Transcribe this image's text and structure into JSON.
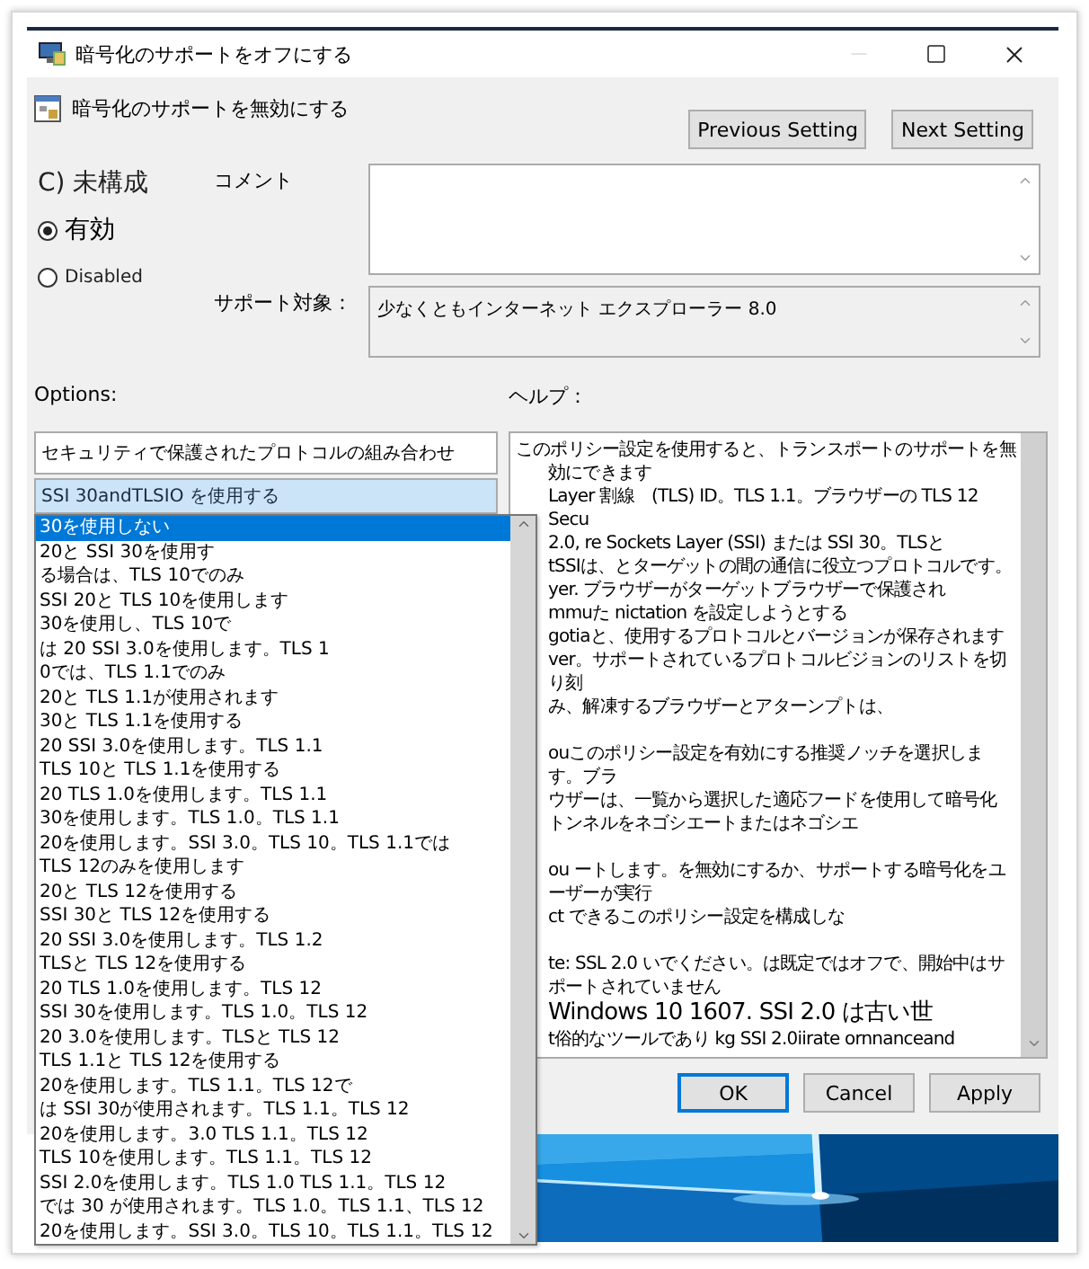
{
  "window": {
    "title": "暗号化のサポートをオフにする"
  },
  "header": {
    "title": "暗号化のサポートを無効にする",
    "buttons": [
      "Previous Setting",
      "Next Setting"
    ]
  },
  "radios": [
    {
      "label": "C) 未構成",
      "kind": "plain",
      "selected": false
    },
    {
      "label": "有効",
      "kind": "radio",
      "selected": true
    },
    {
      "label": "Disabled",
      "kind": "radio",
      "selected": false
    }
  ],
  "comment": {
    "label": "コメント"
  },
  "supported_on": {
    "label": "サポート対象：",
    "value": "少なくともインターネット エクスプローラー 8.0"
  },
  "options": {
    "label": "Options:",
    "group_label": "セキュリティで保護されたプロトコルの組み合わせ",
    "combo_value": "SSI  30andTLSIO を使用する",
    "list": [
      {
        "label": "30を使用しない",
        "selected": true
      },
      {
        "label": "20と SSI 30を使用す",
        "selected": false
      },
      {
        "label": "る場合は、TLS 10でのみ",
        "selected": false
      },
      {
        "label": "SSI 20と TLS 10を使用します",
        "selected": false
      },
      {
        "label": "30を使用し、TLS 10で",
        "selected": false
      },
      {
        "label": "は 20 SSI 3.0を使用します。TLS 1",
        "selected": false
      },
      {
        "label": "0では、TLS 1.1でのみ",
        "selected": false
      },
      {
        "label": "20と TLS 1.1が使用されます",
        "selected": false
      },
      {
        "label": "30と TLS 1.1を使用する",
        "selected": false
      },
      {
        "label": "20 SSI 3.0を使用します。TLS 1.1",
        "selected": false
      },
      {
        "label": "TLS 10と TLS 1.1を使用する",
        "selected": false
      },
      {
        "label": "20 TLS 1.0を使用します。TLS 1.1",
        "selected": false
      },
      {
        "label": "30を使用します。TLS 1.0。TLS 1.1",
        "selected": false
      },
      {
        "label": "20を使用します。SSI 3.0。TLS 10。TLS 1.1では",
        "selected": false
      },
      {
        "label": "TLS 12のみを使用します",
        "selected": false
      },
      {
        "label": "20と TLS 12を使用する",
        "selected": false
      },
      {
        "label": "SSI 30と TLS 12を使用する",
        "selected": false
      },
      {
        "label": "20 SSI 3.0を使用します。TLS 1.2",
        "selected": false
      },
      {
        "label": "TLSと TLS 12を使用する",
        "selected": false
      },
      {
        "label": "20 TLS 1.0を使用します。TLS 12",
        "selected": false
      },
      {
        "label": "SSI 30を使用します。TLS 1.0。TLS 12",
        "selected": false
      },
      {
        "label": "20 3.0を使用します。TLSと TLS 12",
        "selected": false
      },
      {
        "label": "TLS 1.1と TLS 12を使用する",
        "selected": false
      },
      {
        "label": "20を使用します。TLS 1.1。TLS 12で",
        "selected": false
      },
      {
        "label": "は SSI 30が使用されます。TLS 1.1。TLS 12",
        "selected": false
      },
      {
        "label": "20を使用します。3.0 TLS 1.1。TLS 12",
        "selected": false
      },
      {
        "label": "TLS 10を使用します。TLS 1.1。TLS 12",
        "selected": false
      },
      {
        "label": "SSI 2.0を使用します。TLS 1.0 TLS 1.1。TLS 12",
        "selected": false
      },
      {
        "label": "では 30 が使用されます。TLS 1.0。TLS 1.1、TLS 12",
        "selected": false
      },
      {
        "label": "20を使用します。SSI 3.0。TLS 10。TLS 1.1。TLS 12",
        "selected": false
      }
    ]
  },
  "help": {
    "label": "ヘルプ：",
    "lines": [
      {
        "text": "このポリシー設定を使用すると、トランスポートのサポートを無効にできます",
        "kind": "full"
      },
      {
        "text": "Layer 割線　(TLS) ID。TLS 1.1。ブラウザーの TLS 12 Secu",
        "kind": "clipped"
      },
      {
        "text": "2.0, re Sockets Layer (SSI) または SSI 30。TLSと",
        "kind": "clipped"
      },
      {
        "text": "tSSIは、とターゲットの間の通信に役立つプロトコルです。",
        "kind": "clipped"
      },
      {
        "text": "yer. ブラウザーがターゲットブラウザーで保護され",
        "kind": "clipped"
      },
      {
        "text": "mmuた nictation を設定しようとする",
        "kind": "clipped"
      },
      {
        "text": "gotiaと、使用するプロトコルとバージョンが保存されます",
        "kind": "clipped"
      },
      {
        "text": "ver。サポートされているプロトコルビジョンのリストを切り刻",
        "kind": "clipped"
      },
      {
        "text": "み、解凍するブラウザーとアターンプトは、",
        "kind": "clipped"
      },
      {
        "kind": "blank"
      },
      {
        "text": "ouこのポリシー設定を有効にする推奨ノッチを選択します。ブラ",
        "kind": "clipped"
      },
      {
        "text": "ウザーは、一覧から選択した適応フードを使用して暗号化",
        "kind": "clipped"
      },
      {
        "text": "トンネルをネゴシエートまたはネゴシエ",
        "kind": "clipped"
      },
      {
        "kind": "blank"
      },
      {
        "text": "ou ートします。を無効にするか、サポートする暗号化をユーザーが実行",
        "kind": "clipped"
      },
      {
        "text": "ct できるこのポリシー設定を構成しな",
        "kind": "clipped"
      },
      {
        "kind": "blank"
      },
      {
        "text": "te: SSL 2.0 いでください。は既定ではオフで、開始中はサポートされていません",
        "kind": "clipped"
      },
      {
        "text": "Windows 10 1607. SSI 2.0 は古い世",
        "kind": "large"
      },
      {
        "text": "t俗的なツールであり kg SSI 2.0iirate ornnanceand",
        "kind": "clipped"
      }
    ]
  },
  "footer_buttons": [
    {
      "label": "OK",
      "kind": "default"
    },
    {
      "label": "Cancel",
      "kind": "normal"
    },
    {
      "label": "Apply",
      "kind": "normal"
    }
  ]
}
